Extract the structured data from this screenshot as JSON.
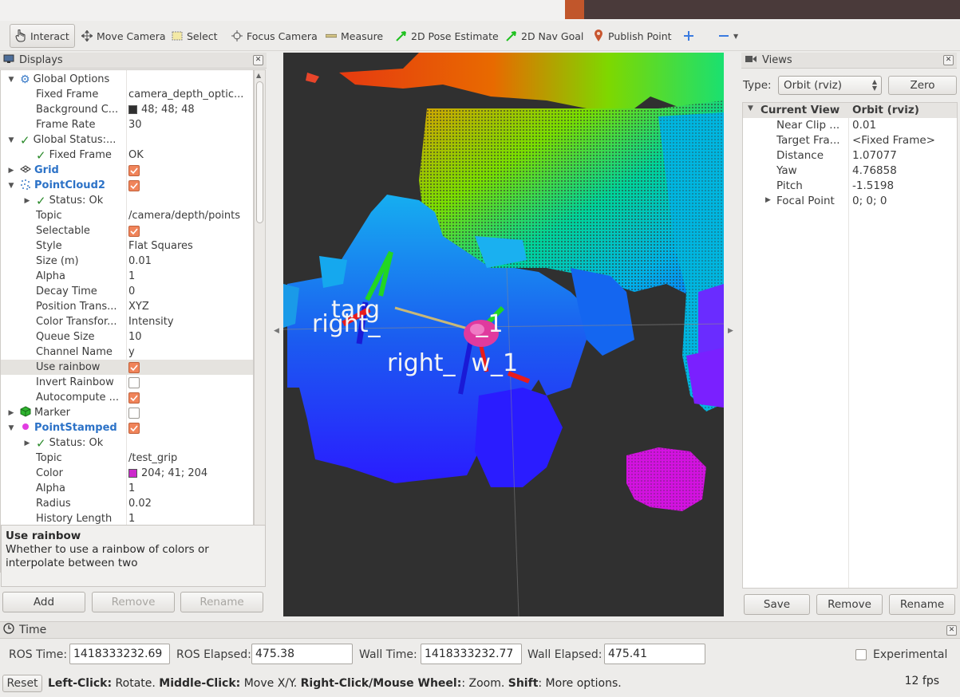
{
  "toolbar": {
    "tools": [
      {
        "label": "Interact",
        "icon": "hand-pointer-icon"
      },
      {
        "label": "Move Camera",
        "icon": "move-arrows-icon"
      },
      {
        "label": "Select",
        "icon": "select-box-icon"
      },
      {
        "label": "Focus Camera",
        "icon": "focus-crosshair-icon"
      },
      {
        "label": "Measure",
        "icon": "ruler-icon"
      },
      {
        "label": "2D Pose Estimate",
        "icon": "green-arrow-icon"
      },
      {
        "label": "2D Nav Goal",
        "icon": "green-arrow-icon"
      },
      {
        "label": "Publish Point",
        "icon": "map-pin-icon"
      }
    ],
    "plus_icon": "plus-icon",
    "minus_icon": "minus-icon"
  },
  "displays": {
    "title": "Displays",
    "rows": [
      {
        "name": "Global Options",
        "value": ""
      },
      {
        "name": "Fixed Frame",
        "value": "camera_depth_optic..."
      },
      {
        "name": "Background C...",
        "value": "48; 48; 48"
      },
      {
        "name": "Frame Rate",
        "value": "30"
      },
      {
        "name": "Global Status:...",
        "value": ""
      },
      {
        "name": "Fixed Frame",
        "value": "OK"
      },
      {
        "name": "Grid",
        "value": ""
      },
      {
        "name": "PointCloud2",
        "value": ""
      },
      {
        "name": "Status: Ok",
        "value": ""
      },
      {
        "name": "Topic",
        "value": "/camera/depth/points"
      },
      {
        "name": "Selectable",
        "value": ""
      },
      {
        "name": "Style",
        "value": "Flat Squares"
      },
      {
        "name": "Size (m)",
        "value": "0.01"
      },
      {
        "name": "Alpha",
        "value": "1"
      },
      {
        "name": "Decay Time",
        "value": "0"
      },
      {
        "name": "Position Trans...",
        "value": "XYZ"
      },
      {
        "name": "Color Transfor...",
        "value": "Intensity"
      },
      {
        "name": "Queue Size",
        "value": "10"
      },
      {
        "name": "Channel Name",
        "value": "y"
      },
      {
        "name": "Use rainbow",
        "value": ""
      },
      {
        "name": "Invert Rainbow",
        "value": ""
      },
      {
        "name": "Autocompute ...",
        "value": ""
      },
      {
        "name": "Marker",
        "value": ""
      },
      {
        "name": "PointStamped",
        "value": ""
      },
      {
        "name": "Status: Ok",
        "value": ""
      },
      {
        "name": "Topic",
        "value": "/test_grip"
      },
      {
        "name": "Color",
        "value": "204; 41; 204"
      },
      {
        "name": "Alpha",
        "value": "1"
      },
      {
        "name": "Radius",
        "value": "0.02"
      },
      {
        "name": "History Length",
        "value": "1"
      }
    ],
    "background_color": "#303030",
    "point_color": "#cc29cc",
    "description_title": "Use rainbow",
    "description_text": "Whether to use a rainbow of colors or interpolate between two",
    "add_label": "Add",
    "remove_label": "Remove",
    "rename_label": "Rename"
  },
  "viewport": {
    "label_a": "right_",
    "label_a_tail": "_1",
    "label_b": "right_",
    "label_b_tail": "w_1",
    "label_c": "targ"
  },
  "views": {
    "title": "Views",
    "type_label": "Type:",
    "type_value": "Orbit (rviz)",
    "zero_label": "Zero",
    "header_name": "Current View",
    "header_value": "Orbit (rviz)",
    "rows": [
      {
        "name": "Near Clip ...",
        "value": "0.01"
      },
      {
        "name": "Target Fra...",
        "value": "<Fixed Frame>"
      },
      {
        "name": "Distance",
        "value": "1.07077"
      },
      {
        "name": "Yaw",
        "value": "4.76858"
      },
      {
        "name": "Pitch",
        "value": "-1.5198"
      },
      {
        "name": "Focal Point",
        "value": "0; 0; 0"
      }
    ],
    "save_label": "Save",
    "remove_label": "Remove",
    "rename_label": "Rename"
  },
  "time": {
    "title": "Time",
    "ros_time_label": "ROS Time:",
    "ros_time": "1418333232.69",
    "ros_elapsed_label": "ROS Elapsed:",
    "ros_elapsed": "475.38",
    "wall_time_label": "Wall Time:",
    "wall_time": "1418333232.77",
    "wall_elapsed_label": "Wall Elapsed:",
    "wall_elapsed": "475.41",
    "experimental_label": "Experimental"
  },
  "status": {
    "reset_label": "Reset",
    "left_click": "Left-Click:",
    "left_click_text": " Rotate. ",
    "middle_click": "Middle-Click:",
    "middle_click_text": " Move X/Y. ",
    "right_click": "Right-Click/Mouse Wheel:",
    "right_click_text": ": Zoom. ",
    "shift": "Shift",
    "shift_text": ": More options.",
    "fps": "12 fps"
  }
}
